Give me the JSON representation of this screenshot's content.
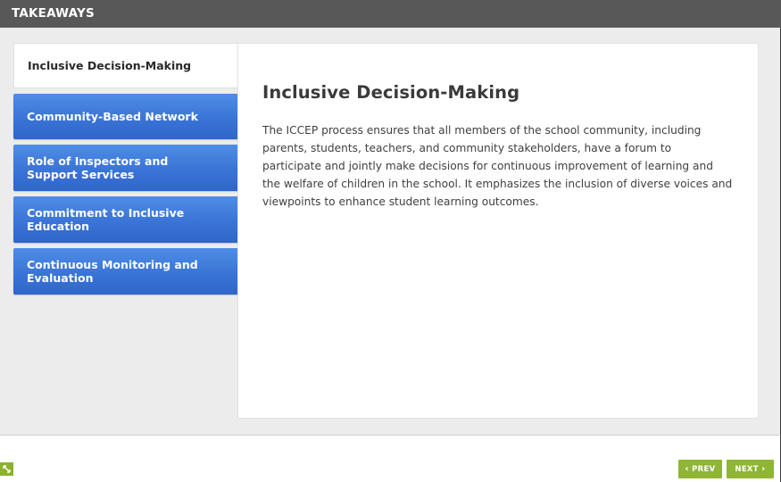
{
  "header": {
    "title": "TAKEAWAYS"
  },
  "tabs": [
    {
      "label": "Inclusive Decision-Making",
      "active": true
    },
    {
      "label": "Community-Based Network",
      "active": false
    },
    {
      "label": "Role of Inspectors and Support Services",
      "active": false
    },
    {
      "label": "Commitment to Inclusive Education",
      "active": false
    },
    {
      "label": "Continuous Monitoring and Evaluation",
      "active": false
    }
  ],
  "content": {
    "title": "Inclusive Decision-Making",
    "body": "The ICCEP process ensures that all members of the school community, including parents, students, teachers, and community stakeholders, have a forum to participate and jointly make decisions for continuous improvement of learning and the welfare of children in the school. It emphasizes the inclusion of diverse voices and viewpoints to enhance student learning outcomes."
  },
  "footer": {
    "prev_label": "PREV",
    "next_label": "NEXT",
    "corner_icon": "resize-icon",
    "accent_color": "#8fb535"
  },
  "colors": {
    "header_bg": "#585858",
    "tab_blue": "#3a74d6",
    "stage_bg": "#ececec"
  }
}
